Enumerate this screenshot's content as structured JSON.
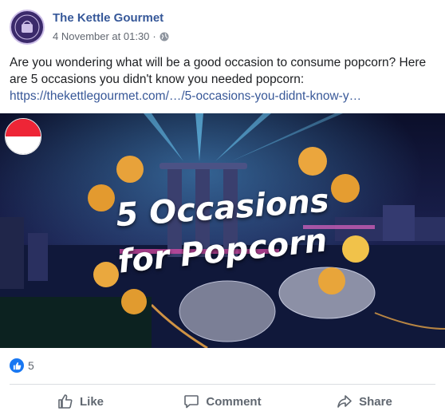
{
  "post": {
    "page_name": "The Kettle Gourmet",
    "timestamp": "4 November at 01:30",
    "separator": "·",
    "text": "Are you wondering what will be a good occasion to consume popcorn? Here are 5 occasions you didn't know you needed popcorn:",
    "link_text": "https://thekettlegourmet.com/…/5-occasions-you-didnt-know-y…",
    "image": {
      "title_line1": "5 Occasions",
      "title_line2": "for Popcorn"
    }
  },
  "reactions": {
    "count": "5"
  },
  "actions": {
    "like_label": "Like",
    "comment_label": "Comment",
    "share_label": "Share"
  },
  "colors": {
    "link": "#385898",
    "name": "#365899",
    "like_blue": "#1877f2"
  }
}
